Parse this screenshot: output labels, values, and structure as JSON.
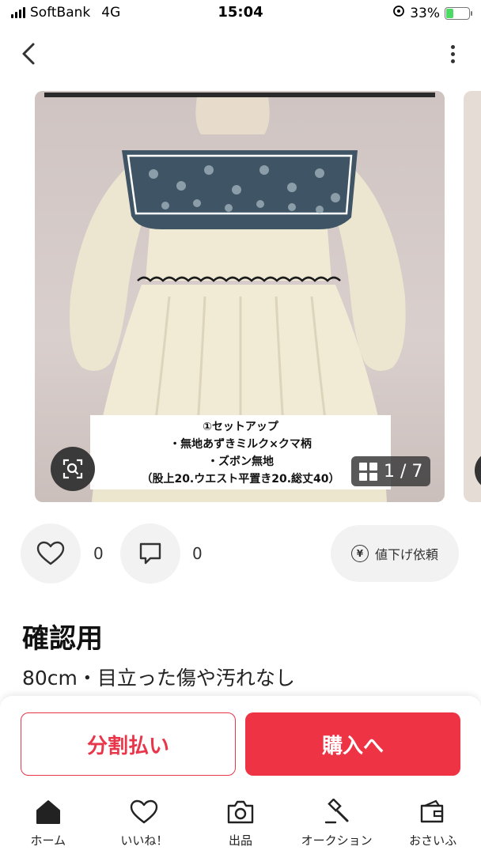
{
  "status_bar": {
    "carrier": "SoftBank",
    "network": "4G",
    "time": "15:04",
    "battery_percent": "33%",
    "battery_level": 0.33
  },
  "nav": {
    "back_icon": "chevron-left-icon",
    "more_icon": "more-vertical-icon"
  },
  "gallery": {
    "caption_lines": [
      "①セットアップ",
      "・無地あずきミルク×クマ柄",
      "・ズボン無地",
      "（股上20.ウエスト平置き20.総丈40）"
    ],
    "counter": "1 / 7",
    "zoom_icon": "zoom-scan-icon",
    "grid_icon": "grid-icon"
  },
  "actions": {
    "like_count": "0",
    "comment_count": "0",
    "price_request_label": "値下げ依頼"
  },
  "item": {
    "title": "確認用",
    "subtitle": "80cm・目立った傷や汚れなし"
  },
  "buy_bar": {
    "installment_label": "分割払い",
    "buy_label": "購入へ"
  },
  "tabs": [
    {
      "label": "ホーム",
      "icon": "home-icon"
    },
    {
      "label": "いいね！",
      "icon": "heart-icon"
    },
    {
      "label": "出品",
      "icon": "camera-icon"
    },
    {
      "label": "オークション",
      "icon": "gavel-icon"
    },
    {
      "label": "おさいふ",
      "icon": "wallet-icon"
    }
  ],
  "colors": {
    "accent_red": "#ee3345",
    "battery_green": "#4cd964"
  }
}
